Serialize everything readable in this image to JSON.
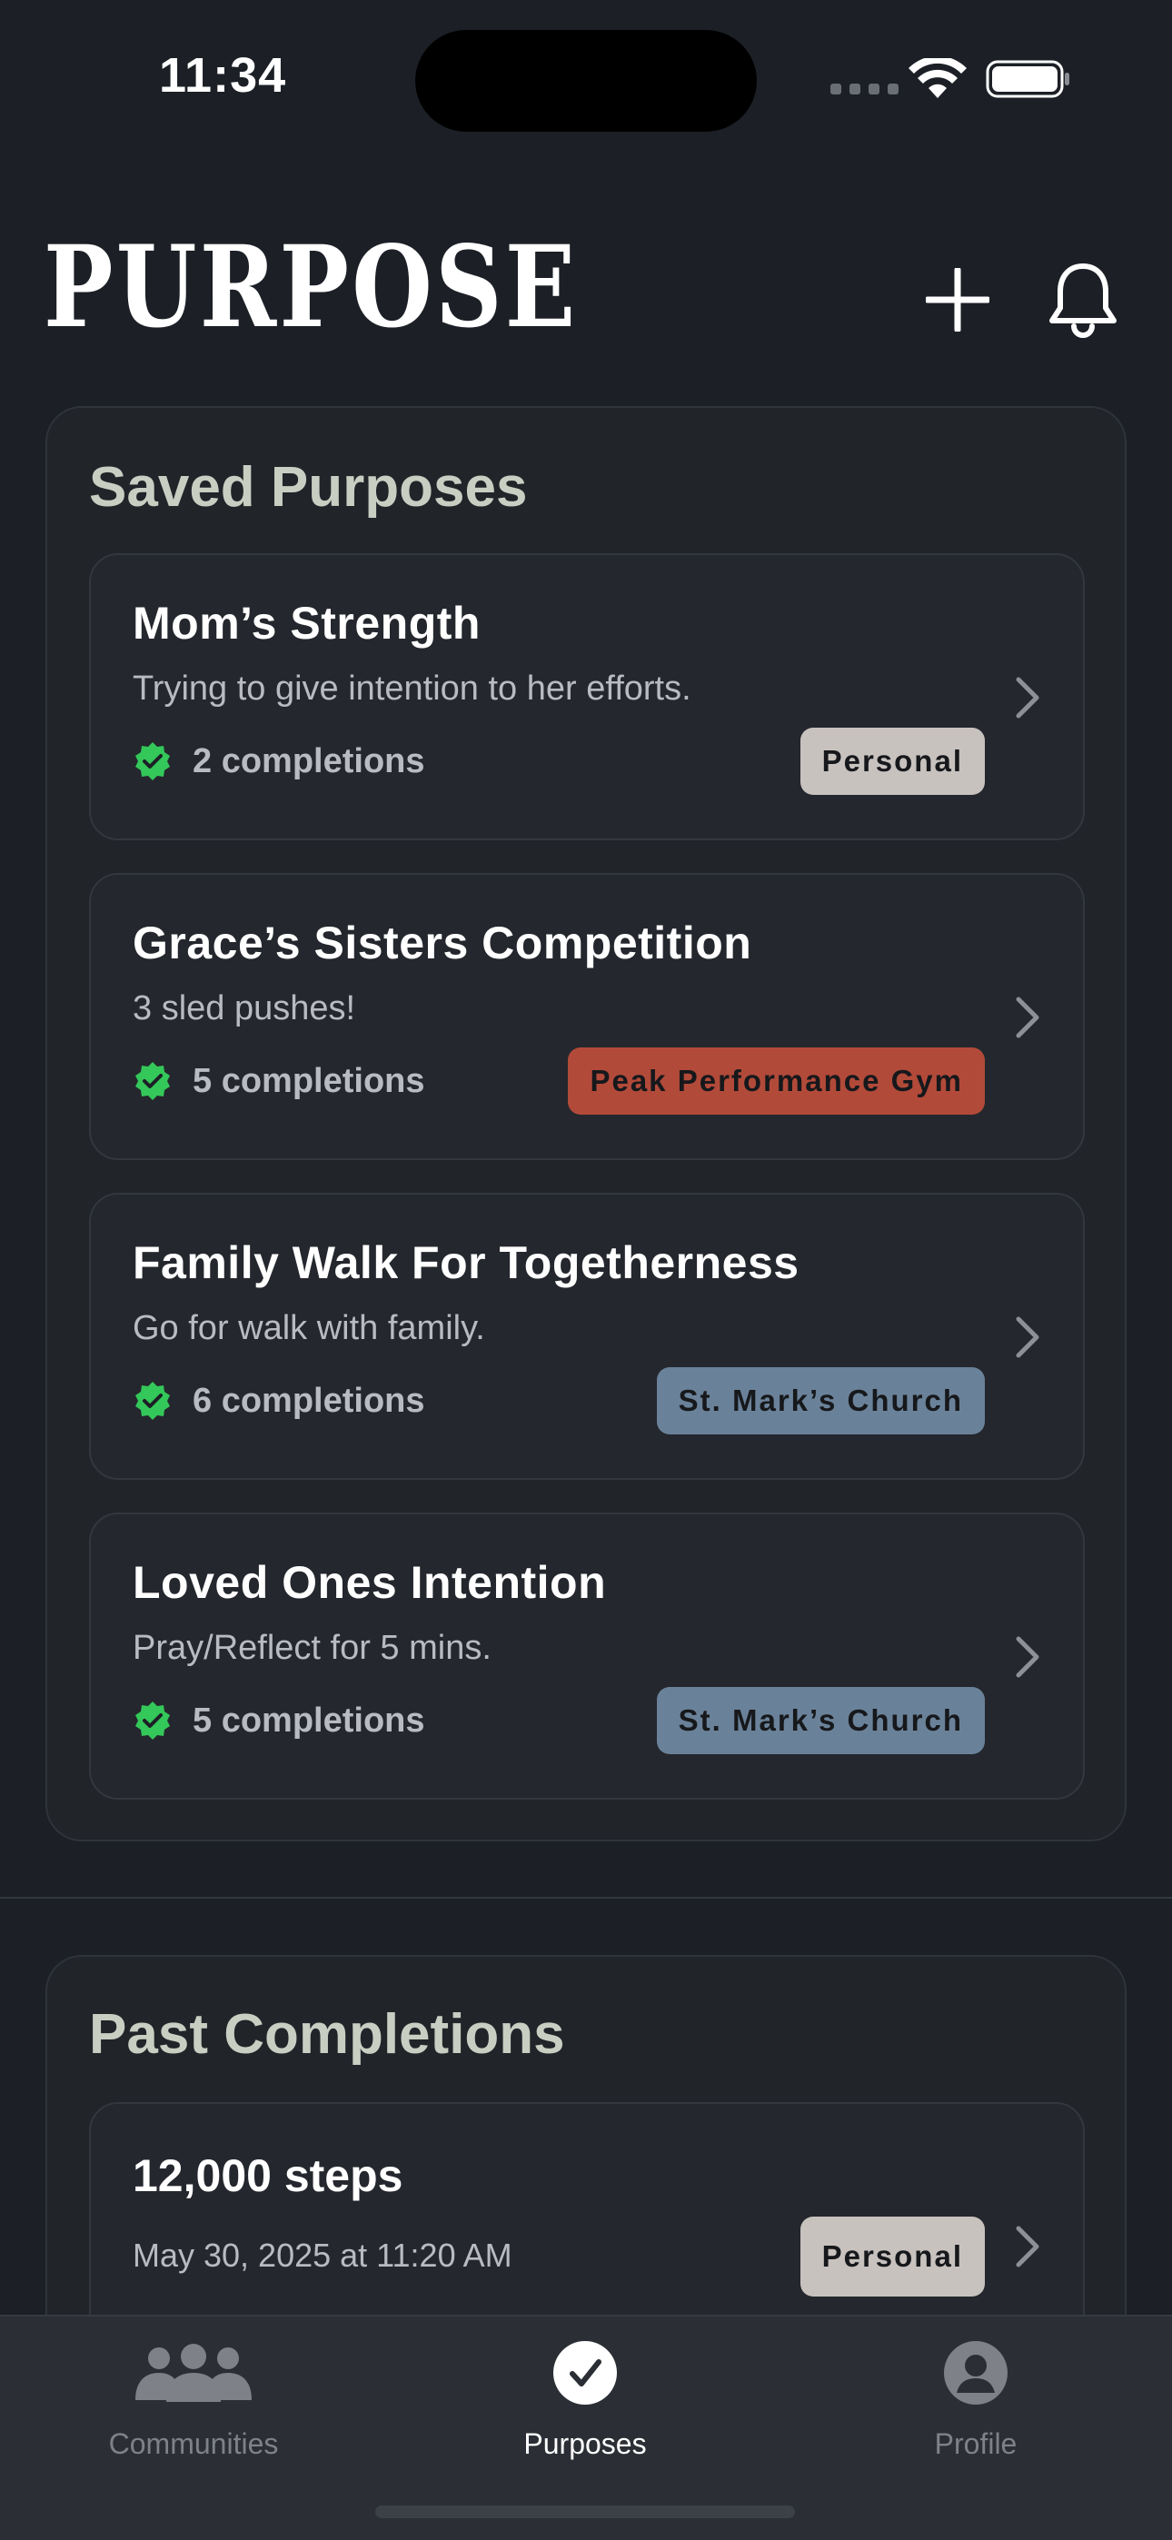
{
  "status_bar": {
    "time": "11:34"
  },
  "header": {
    "logo": "PURPOSE"
  },
  "saved": {
    "title": "Saved Purposes",
    "items": [
      {
        "title": "Mom’s Strength",
        "subtitle": "Trying to give intention to her efforts.",
        "completions": "2 completions",
        "tag": "Personal",
        "tag_color": "#c8c2bf"
      },
      {
        "title": "Grace’s Sisters Competition",
        "subtitle": "3 sled pushes!",
        "completions": "5 completions",
        "tag": "Peak Performance Gym",
        "tag_color": "#b24a3a"
      },
      {
        "title": "Family Walk For Togetherness",
        "subtitle": "Go for walk with family.",
        "completions": "6 completions",
        "tag": "St. Mark’s Church",
        "tag_color": "#6a8299"
      },
      {
        "title": "Loved Ones Intention",
        "subtitle": "Pray/Reflect for 5 mins.",
        "completions": "5 completions",
        "tag": "St. Mark’s Church",
        "tag_color": "#6a8299"
      }
    ]
  },
  "past": {
    "title": "Past Completions",
    "items": [
      {
        "title": "12,000 steps",
        "date": "May 30, 2025 at 11:20 AM",
        "tag": "Personal",
        "tag_color": "#c8c2bf"
      }
    ]
  },
  "tabs": [
    {
      "label": "Communities",
      "icon": "people-icon",
      "active": false
    },
    {
      "label": "Purposes",
      "icon": "checkmark-circle-icon",
      "active": true
    },
    {
      "label": "Profile",
      "icon": "person-circle-icon",
      "active": false
    }
  ],
  "colors": {
    "background": "#1c2026",
    "card": "#212429",
    "check_green": "#34c759",
    "title_sage": "#c9cec2"
  }
}
